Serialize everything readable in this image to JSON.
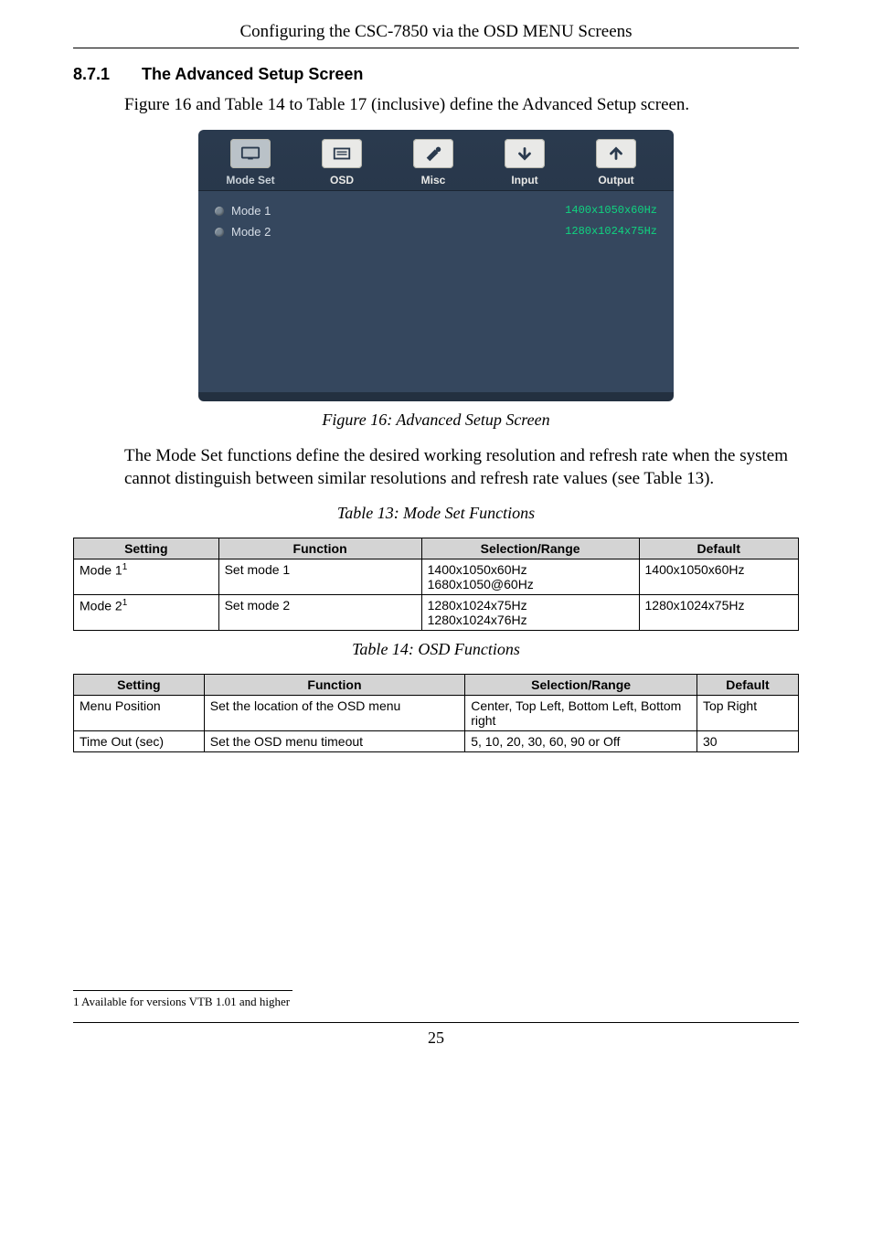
{
  "header": "Configuring the CSC-7850 via the OSD MENU Screens",
  "section": {
    "number": "8.7.1",
    "title": "The Advanced Setup Screen"
  },
  "intro": "Figure 16 and Table 14 to Table 17 (inclusive) define the Advanced Setup screen.",
  "osd": {
    "tabs": [
      {
        "label": "Mode Set",
        "name": "tab-mode-set",
        "active": true
      },
      {
        "label": "OSD",
        "name": "tab-osd",
        "active": false
      },
      {
        "label": "Misc",
        "name": "tab-misc",
        "active": false
      },
      {
        "label": "Input",
        "name": "tab-input",
        "active": false
      },
      {
        "label": "Output",
        "name": "tab-output",
        "active": false
      }
    ],
    "rows": [
      {
        "label": "Mode 1",
        "value": "1400x1050x60Hz"
      },
      {
        "label": "Mode 2",
        "value": "1280x1024x75Hz"
      }
    ]
  },
  "fig16_caption": "Figure 16: Advanced Setup Screen",
  "para2": "The Mode Set functions define the desired working resolution and refresh rate when the system cannot distinguish between similar resolutions and refresh rate values (see Table 13).",
  "table13": {
    "caption": "Table 13: Mode Set Functions",
    "headers": [
      "Setting",
      "Function",
      "Selection/Range",
      "Default"
    ],
    "rows": [
      {
        "setting": "Mode 1",
        "sup": "1",
        "func": "Set mode 1",
        "range": "1400x1050x60Hz\n1680x1050@60Hz",
        "def": "1400x1050x60Hz"
      },
      {
        "setting": "Mode 2",
        "sup": "1",
        "func": "Set mode 2",
        "range": "1280x1024x75Hz\n1280x1024x76Hz",
        "def": "1280x1024x75Hz"
      }
    ]
  },
  "table14": {
    "caption": "Table 14: OSD Functions",
    "headers": [
      "Setting",
      "Function",
      "Selection/Range",
      "Default"
    ],
    "rows": [
      {
        "setting": "Menu Position",
        "func": "Set the location of the OSD menu",
        "range": "Center, Top Left, Bottom Left, Bottom right",
        "def": "Top Right"
      },
      {
        "setting": "Time Out (sec)",
        "func": "Set the OSD menu timeout",
        "range": "5, 10, 20, 30, 60, 90 or Off",
        "def": "30"
      }
    ]
  },
  "footnote": "1 Available for versions VTB 1.01 and higher",
  "page_number": "25"
}
